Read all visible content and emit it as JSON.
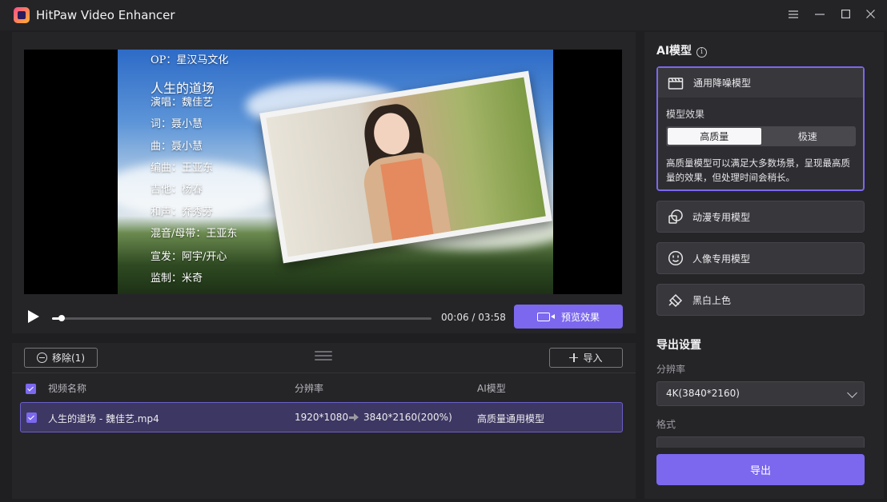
{
  "window": {
    "title": "HitPaw Video Enhancer"
  },
  "player": {
    "credits": [
      "OP：星汉马文化",
      "人生的道场",
      "演唱：魏佳艺",
      "词：聂小慧",
      "曲：聂小慧",
      "编曲：王亚东",
      "吉他：杨春",
      "和声：乔秀芬",
      "混音/母带：王亚东",
      "宣发：阿宇/开心",
      "监制：米奇"
    ],
    "progress": 0.026,
    "current_time": "00:06",
    "time_separator": "/",
    "total_time": "03:58",
    "preview_label": "预览效果"
  },
  "list": {
    "remove_label": "移除(1)",
    "import_label": "导入",
    "headers": {
      "name": "视频名称",
      "resolution": "分辨率",
      "model": "AI模型"
    },
    "rows": [
      {
        "name": "人生的道场 - 魏佳艺.mp4",
        "from_resolution": "1920*1080",
        "to_resolution": "3840*2160(200%)",
        "model": "高质量通用模型"
      }
    ]
  },
  "side": {
    "ai_model_title": "AI模型",
    "models": {
      "general": "通用降噪模型",
      "anime": "动漫专用模型",
      "portrait": "人像专用模型",
      "colorize": "黑白上色"
    },
    "effect_label": "模型效果",
    "effect_options": [
      "高质量",
      "极速"
    ],
    "effect_selected": "高质量",
    "description": "高质量模型可以满足大多数场景，呈现最高质量的效果，但处理时间会稍长。",
    "export_settings_title": "导出设置",
    "resolution_label": "分辨率",
    "resolution_value": "4K(3840*2160)",
    "format_label": "格式",
    "export_label": "导出"
  },
  "colors": {
    "accent": "#7b68ee",
    "panel": "#252528",
    "card": "#38383c"
  }
}
